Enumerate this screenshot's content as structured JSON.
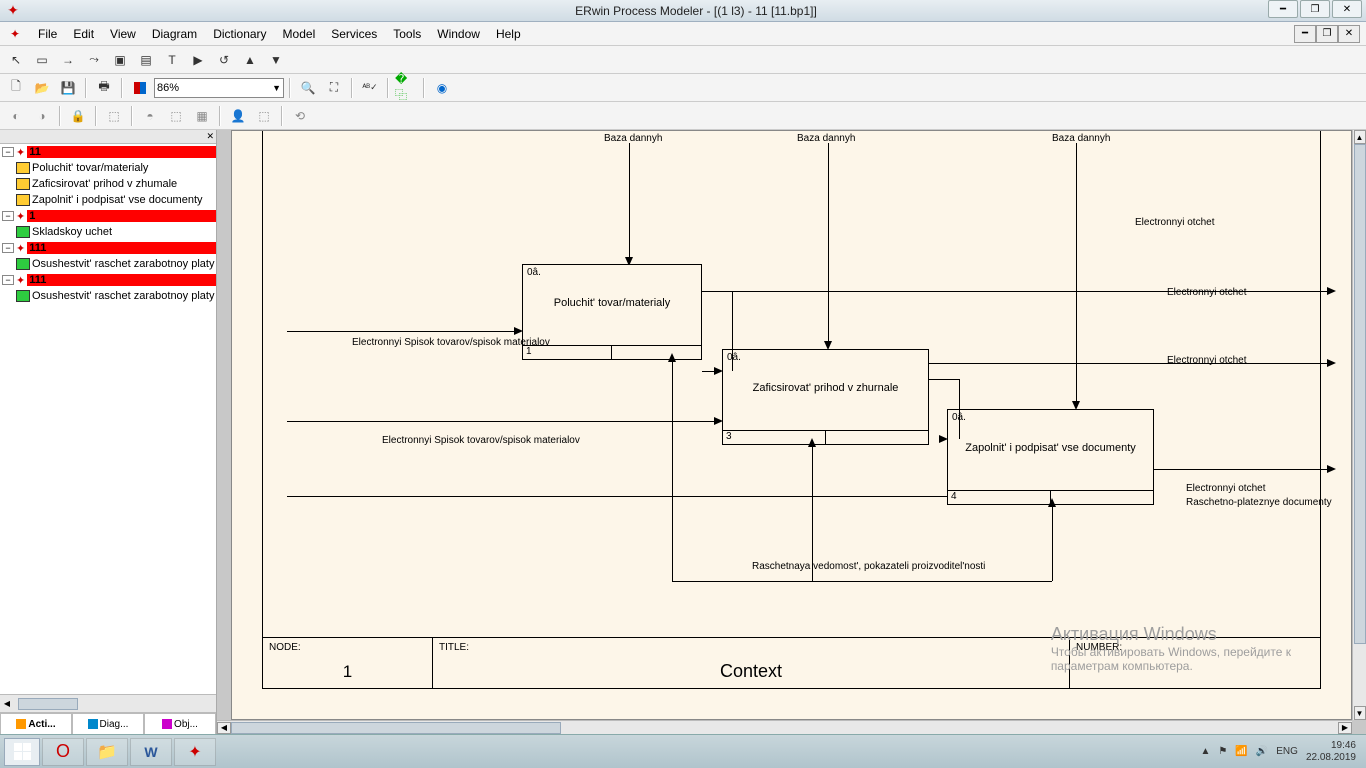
{
  "titlebar": {
    "title": "ERwin Process Modeler - [(1 l3)  - 11  [11.bp1]]"
  },
  "menus": [
    "File",
    "Edit",
    "View",
    "Diagram",
    "Dictionary",
    "Model",
    "Services",
    "Tools",
    "Window",
    "Help"
  ],
  "zoom": "86%",
  "tree": {
    "n1": "11",
    "n1a": "Poluchit' tovar/materialy",
    "n1b": "Zaficsirovat' prihod v zhumale",
    "n1c": "Zapolnit' i podpisat' vse documenty",
    "n2": "1",
    "n2a": "Skladskoy uchet",
    "n3": "111",
    "n3a": "Osushestvit' raschet  zarabotnoy platy",
    "n4": "111",
    "n4a": "Osushestvit' raschet  zarabotnoy platy"
  },
  "side_tabs": {
    "t1": "Acti...",
    "t2": "Diag...",
    "t3": "Obj..."
  },
  "diagram": {
    "baza": "Baza dannyh",
    "box1": {
      "ob": "0â.",
      "name": "Poluchit' tovar/materialy",
      "num": "1"
    },
    "box2": {
      "ob": "0â.",
      "name": "Zaficsirovat' prihod v zhurnale",
      "num": "3"
    },
    "box3": {
      "ob": "0â.",
      "name": "Zapolnit' i podpisat' vse documenty",
      "num": "4"
    },
    "in1": "Electronnyi Spisok tovarov/spisok materialov",
    "in2": "Electronnyi Spisok tovarov/spisok materialov",
    "mech": "Raschetnaya vedomost', pokazateli proizvoditel'nosti",
    "out1": "Electronnyi otchet",
    "out2": "Electronnyi otchet",
    "out3": "Electronnyi otchet",
    "out4": "Electronnyi otchet",
    "out5": "Raschetno-plateznye documenty"
  },
  "frame": {
    "node_label": "NODE:",
    "node_val": "1",
    "title_label": "TITLE:",
    "title_val": "Context",
    "number_label": "NUMBER:"
  },
  "watermark": {
    "l1": "Активация Windows",
    "l2": "Чтобы активировать Windows, перейдите к",
    "l3": "параметрам компьютера."
  },
  "tray": {
    "lang": "ENG",
    "time": "19:46",
    "date": "22.08.2019"
  }
}
